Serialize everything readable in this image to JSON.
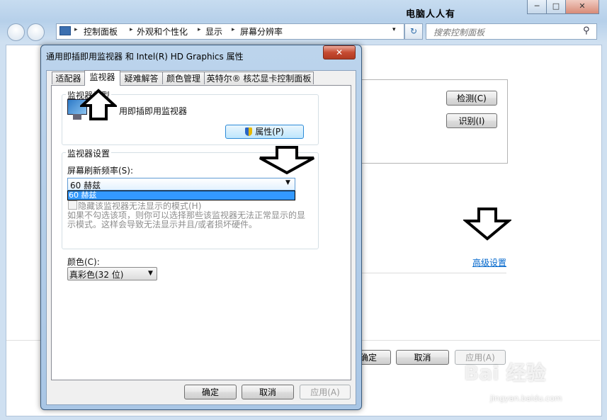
{
  "background_window": {
    "title_overlay": "电脑人人有",
    "caption_buttons": [
      "─",
      "□",
      "✕"
    ],
    "breadcrumb": [
      "控制面板",
      "外观和个性化",
      "显示",
      "屏幕分辨率"
    ],
    "breadcrumb_sep": "▸",
    "address_dropdown": "▾",
    "refresh_icon": "↻",
    "search_placeholder": "搜索控制面板",
    "search_icon": "⚲",
    "detect_label": "检测(C)",
    "identify_label": "识别(I)",
    "advanced_link": "高级设置",
    "ok_label": "确定",
    "cancel_label": "取消",
    "apply_label": "应用(A)"
  },
  "dialog": {
    "title": "通用即插即用监视器 和 Intel(R) HD Graphics 属性",
    "close_glyph": "✕",
    "tabs": [
      {
        "label": "适配器",
        "active": false
      },
      {
        "label": "监视器",
        "active": true
      },
      {
        "label": "疑难解答",
        "active": false
      },
      {
        "label": "颜色管理",
        "active": false
      },
      {
        "label": "英特尔® 核芯显卡控制面板",
        "active": false
      }
    ],
    "monitor_type_group": "监视器类型",
    "monitor_name": "用即插即用监视器",
    "properties_button": "属性(P)",
    "settings_group": "监视器设置",
    "refresh_rate_label": "屏幕刷新频率(S):",
    "refresh_rate_value": "60 赫兹",
    "refresh_rate_options": [
      "60 赫兹"
    ],
    "hide_modes_label": "隐藏该监视器无法显示的模式(H)",
    "hide_modes_checked": false,
    "hide_modes_desc": "如果不勾选该项，则你可以选择那些该监视器无法正常显示的显示模式。这样会导致无法显示并且/或者损坏硬件。",
    "colors_label": "颜色(C):",
    "colors_value": "真彩色(32 位)",
    "dropdown_arrow": "▼",
    "ok_label": "确定",
    "cancel_label": "取消",
    "apply_label": "应用(A)"
  },
  "watermark": {
    "main": "Bai 经验",
    "sub": "jingyan.baidu.com"
  }
}
